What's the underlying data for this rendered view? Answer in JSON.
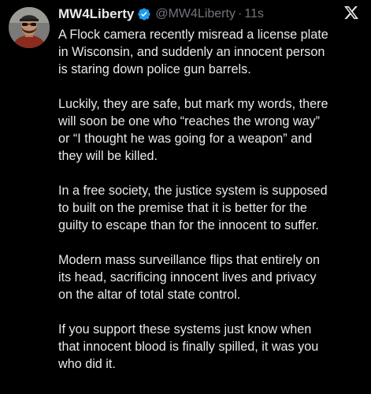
{
  "tweet": {
    "display_name": "MW4Liberty",
    "handle": "@MW4Liberty",
    "separator": "·",
    "timestamp": "11s",
    "verified_badge_color": "#1d9bf0",
    "icons": {
      "verified": "verified-badge-icon",
      "platform": "x-logo-icon"
    },
    "paragraphs": [
      "A Flock camera recently misread a license plate\nin Wisconsin, and suddenly an innocent person\nis staring down police gun barrels.",
      "Luckily, they are safe, but mark my words, there\nwill soon be one who “reaches the wrong way”\nor “I thought he was going for a weapon” and\nthey will be killed.",
      "In a free society, the justice system is supposed\nto built on the premise that it is better for the\nguilty to escape than for the innocent to suffer.",
      "Modern mass surveillance flips that entirely on\nits head, sacrificing innocent lives and privacy\non the altar of total state control.",
      "If you support these systems just know when\nthat innocent blood is finally spilled, it was you\nwho did it."
    ]
  }
}
